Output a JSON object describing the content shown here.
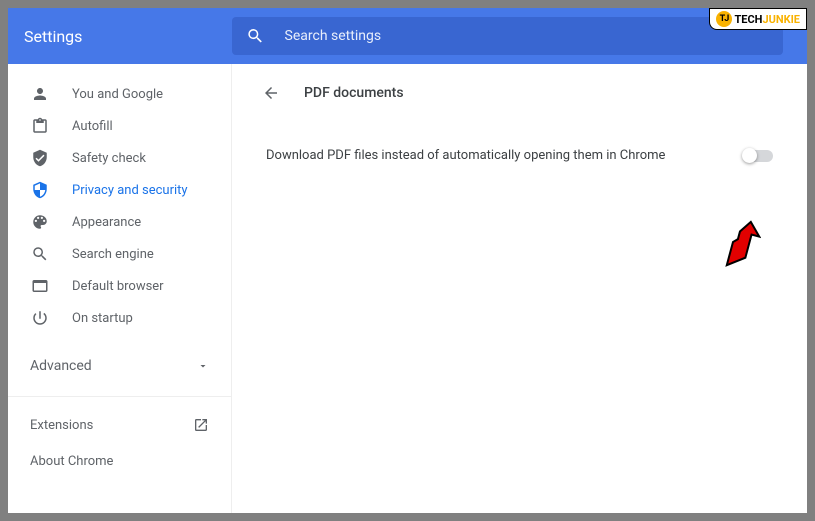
{
  "header": {
    "title": "Settings",
    "search_placeholder": "Search settings"
  },
  "sidebar": {
    "items": [
      {
        "label": "You and Google"
      },
      {
        "label": "Autofill"
      },
      {
        "label": "Safety check"
      },
      {
        "label": "Privacy and security"
      },
      {
        "label": "Appearance"
      },
      {
        "label": "Search engine"
      },
      {
        "label": "Default browser"
      },
      {
        "label": "On startup"
      }
    ],
    "advanced": "Advanced",
    "extensions": "Extensions",
    "about": "About Chrome"
  },
  "content": {
    "page_title": "PDF documents",
    "setting_label": "Download PDF files instead of automatically opening them in Chrome",
    "toggle_on": false
  },
  "watermark": {
    "tj": "TJ",
    "tech": "TECH",
    "junkie": "JUNKIE"
  }
}
